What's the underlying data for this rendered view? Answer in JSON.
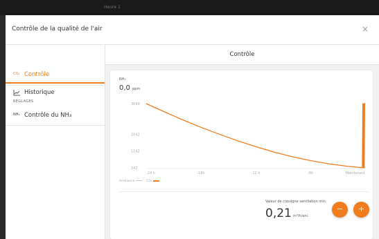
{
  "window": {
    "title": "Heure 1"
  },
  "dialog": {
    "title": "Contrôle de la qualité de l'air",
    "close_label": "×"
  },
  "sidebar": {
    "items": [
      {
        "icon": "CO₂",
        "label": "Contrôle",
        "active": true
      },
      {
        "icon": "chart-icon",
        "label": "Historique",
        "active": false
      }
    ],
    "section_label": "RÉGLAGES",
    "settings_items": [
      {
        "icon": "NH₃",
        "label": "Contrôle du NH₃"
      }
    ]
  },
  "content": {
    "title": "Contrôle",
    "gas_label": "NH₃",
    "reading_value": "0,0",
    "reading_unit": "ppm",
    "legend": [
      {
        "label": "Ambiance",
        "color": "#c8c8c8"
      },
      {
        "label": "CO₂",
        "color": "#f07c1e"
      }
    ],
    "setpoint_label": "Valeur de consigne ventilation min.",
    "setpoint_value": "0,21",
    "setpoint_unit": "m³/h/ani.",
    "minus_label": "−",
    "plus_label": "+"
  },
  "colors": {
    "accent": "#f07c1e"
  },
  "chart_data": {
    "type": "line",
    "x_tick_labels": [
      "-24 h",
      "-18h",
      "-12 h",
      "-6h",
      "Maintenant"
    ],
    "y_tick_labels": [
      "3690",
      "2042",
      "1142",
      "242"
    ],
    "ylim": [
      242,
      3690
    ],
    "xlim": [
      -24,
      0
    ],
    "series": [
      {
        "name": "CO₂",
        "color": "#f07c1e",
        "x": [
          -24,
          -22,
          -20,
          -18,
          -16,
          -14,
          -12,
          -10,
          -8,
          -6,
          -4,
          -2,
          -0.5,
          -0.3,
          -0.25,
          -0.2,
          -0.15,
          -0.1,
          -0.05,
          0
        ],
        "y": [
          3690,
          3250,
          2820,
          2420,
          2050,
          1700,
          1380,
          1090,
          840,
          630,
          460,
          330,
          260,
          242,
          3690,
          242,
          3690,
          242,
          3690,
          3690
        ]
      }
    ]
  }
}
